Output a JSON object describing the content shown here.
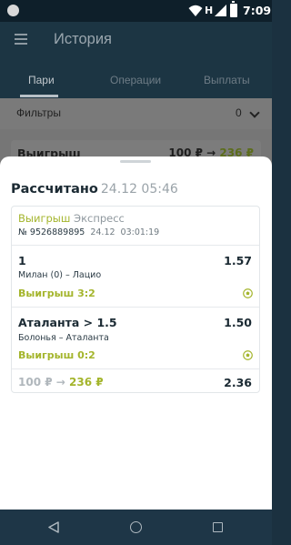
{
  "status_bar": {
    "network": "H",
    "time": "7:09"
  },
  "header": {
    "title": "История",
    "tabs": [
      {
        "label": "Пари",
        "active": true
      },
      {
        "label": "Операции",
        "active": false
      },
      {
        "label": "Выплаты",
        "active": false
      }
    ]
  },
  "filters": {
    "label": "Фильтры",
    "count": "0"
  },
  "behind_card": {
    "result": "Выигрыш",
    "stake": "100 ₽",
    "arrow": "→",
    "payout": "236 ₽"
  },
  "sheet": {
    "title": "Рассчитано",
    "date": "24.12 05:46",
    "bet": {
      "result": "Выигрыш",
      "type": "Экспресс",
      "number": "№ 9526889895",
      "date": "24.12",
      "time": "03:01:19",
      "events": [
        {
          "pick": "1",
          "coef": "1.57",
          "match": "Милан (0) – Лацио",
          "result": "Выигрыш 3:2"
        },
        {
          "pick": "Аталанта > 1.5",
          "coef": "1.50",
          "match": "Болонья – Аталанта",
          "result": "Выигрыш 0:2"
        }
      ],
      "stake": "100 ₽",
      "arrow": "→",
      "payout": "236 ₽",
      "total_coef": "2.36"
    }
  },
  "colors": {
    "win": "#a4b52c",
    "header_bg": "#1c3543",
    "dark_text": "#1b2a33"
  },
  "icons": {
    "menu": "menu-icon",
    "sport": "football-icon",
    "nav_back": "back-icon",
    "nav_home": "home-icon",
    "nav_recent": "recent-apps-icon"
  }
}
